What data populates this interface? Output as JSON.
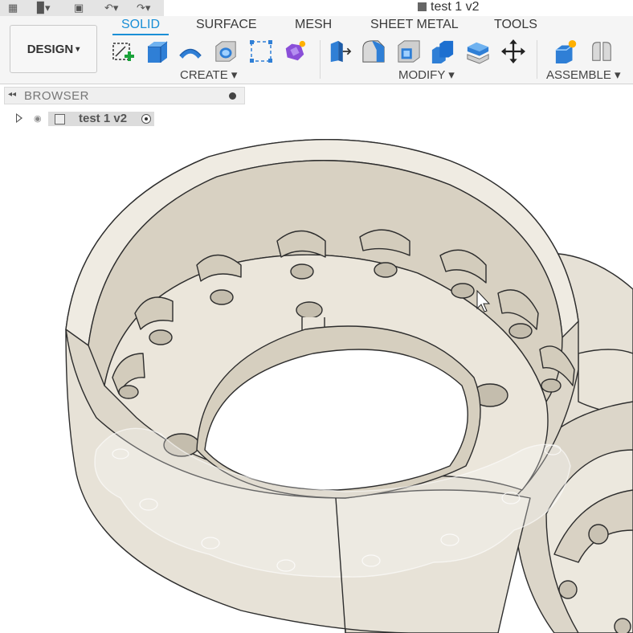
{
  "window": {
    "document_title": "test 1 v2"
  },
  "quick_access": {
    "icons": [
      "grid-icon",
      "file-icon",
      "save-icon",
      "undo-icon",
      "redo-icon"
    ]
  },
  "workspace": {
    "button_label": "DESIGN",
    "caret": "▾"
  },
  "tabs": [
    {
      "label": "SOLID",
      "active": true
    },
    {
      "label": "SURFACE",
      "active": false
    },
    {
      "label": "MESH",
      "active": false
    },
    {
      "label": "SHEET METAL",
      "active": false
    },
    {
      "label": "TOOLS",
      "active": false
    }
  ],
  "groups": {
    "create": {
      "label": "CREATE ▾",
      "tools": [
        "create-sketch-icon",
        "extrude-icon",
        "revolve-icon",
        "hole-icon",
        "pattern-icon",
        "form-icon"
      ]
    },
    "modify": {
      "label": "MODIFY ▾",
      "tools": [
        "press-pull-icon",
        "fillet-icon",
        "shell-icon",
        "combine-icon",
        "offset-face-icon",
        "move-icon"
      ]
    },
    "assemble": {
      "label": "ASSEMBLE ▾",
      "tools": [
        "new-component-icon",
        "joint-icon"
      ]
    }
  },
  "colors": {
    "accent": "#1a8fd6",
    "part": "#e9e4d9",
    "part_shadow": "#cfc8b9",
    "edge": "#2d2d2d"
  },
  "browser": {
    "title": "BROWSER",
    "root_item": {
      "label": "test 1 v2"
    }
  }
}
